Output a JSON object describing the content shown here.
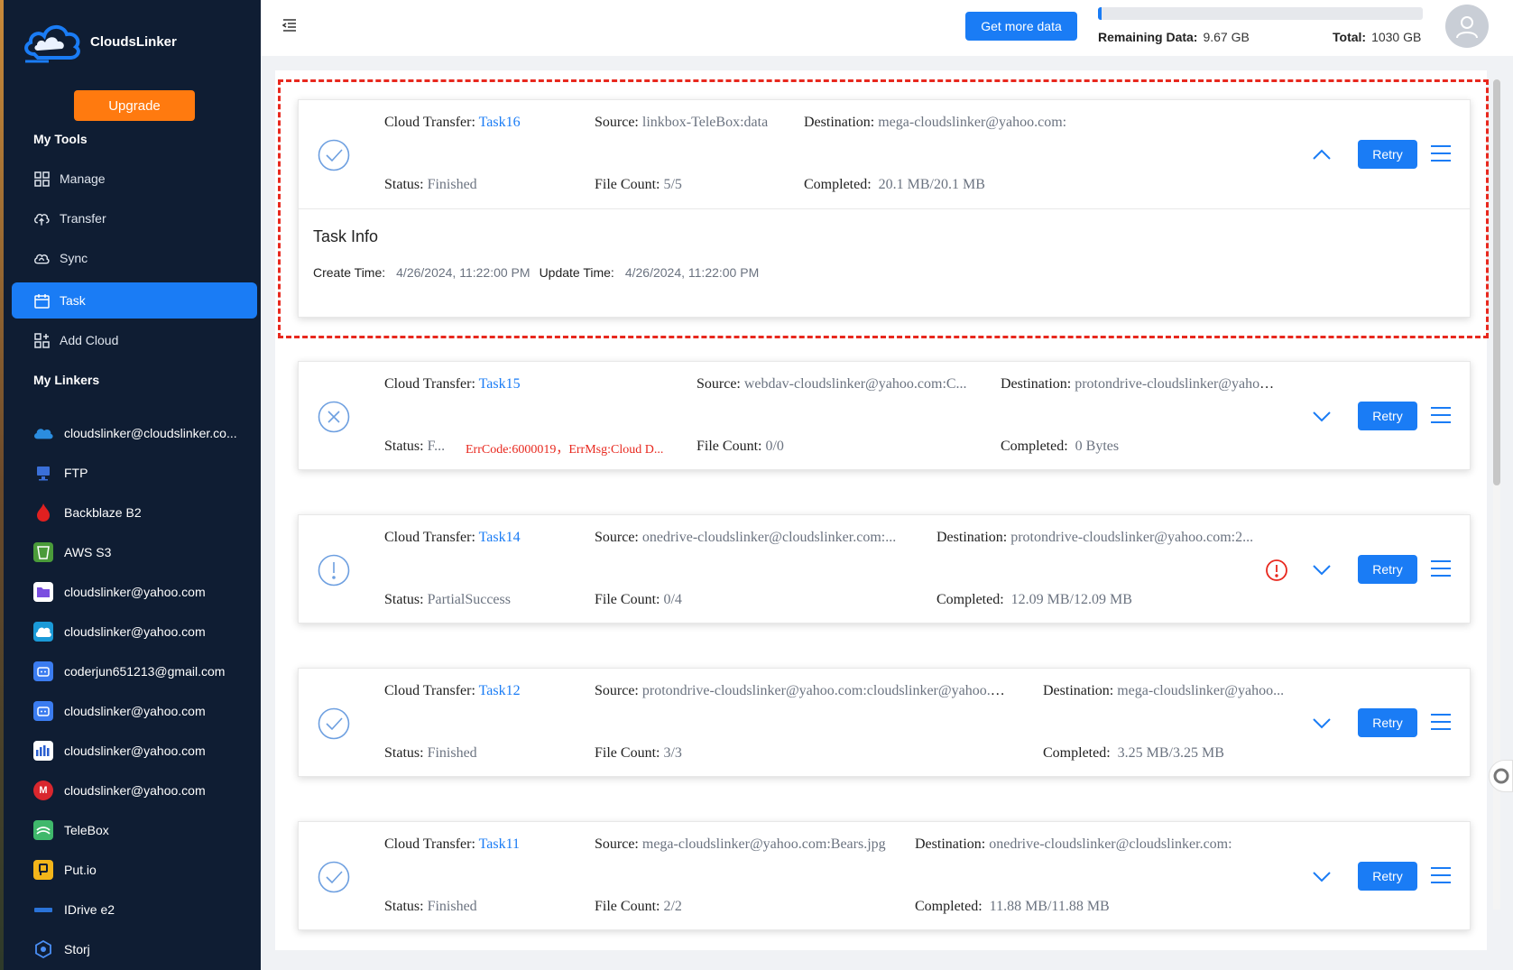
{
  "app": {
    "name": "CloudsLinker"
  },
  "sidebar": {
    "upgrade_label": "Upgrade",
    "my_tools_title": "My Tools",
    "tools": [
      {
        "label": "Manage",
        "icon": "grid-icon"
      },
      {
        "label": "Transfer",
        "icon": "cloud-upload-icon"
      },
      {
        "label": "Sync",
        "icon": "cloud-sync-icon"
      },
      {
        "label": "Task",
        "icon": "calendar-icon",
        "active": true
      },
      {
        "label": "Add Cloud",
        "icon": "add-grid-icon"
      }
    ],
    "my_linkers_title": "My Linkers",
    "linkers": [
      {
        "label": "cloudslinker@cloudslinker.co...",
        "icon": "onedrive-icon",
        "color": "#2b8de0"
      },
      {
        "label": "FTP",
        "icon": "ftp-icon",
        "color": "#3a6fd8"
      },
      {
        "label": "Backblaze B2",
        "icon": "backblaze-icon",
        "color": "#e02020"
      },
      {
        "label": "AWS S3",
        "icon": "aws-s3-icon",
        "color": "#4a9b3a"
      },
      {
        "label": "cloudslinker@yahoo.com",
        "icon": "protondrive-icon",
        "color": "#7a4ee0"
      },
      {
        "label": "cloudslinker@yahoo.com",
        "icon": "pcloud-icon",
        "color": "#1a9ad8"
      },
      {
        "label": "coderjun651213@gmail.com",
        "icon": "box-bot-icon",
        "color": "#3b7cf0"
      },
      {
        "label": "cloudslinker@yahoo.com",
        "icon": "box-bot-icon",
        "color": "#3b7cf0"
      },
      {
        "label": "cloudslinker@yahoo.com",
        "icon": "bars-icon",
        "color": "#2a5fd0"
      },
      {
        "label": "cloudslinker@yahoo.com",
        "icon": "mega-icon",
        "color": "#d9272e"
      },
      {
        "label": "TeleBox",
        "icon": "telebox-icon",
        "color": "#3fb86b"
      },
      {
        "label": "Put.io",
        "icon": "putio-icon",
        "color": "#f3b51a"
      },
      {
        "label": "IDrive e2",
        "icon": "idrive-icon",
        "color": "#2a73d8"
      },
      {
        "label": "Storj",
        "icon": "storj-icon",
        "color": "#2a5fd0"
      }
    ]
  },
  "header": {
    "get_more_label": "Get more data",
    "remaining_label": "Remaining Data:",
    "remaining_value": "9.67 GB",
    "total_label": "Total:",
    "total_value": "1030 GB",
    "used_fraction": 0.01
  },
  "labels": {
    "cloud_transfer": "Cloud Transfer:",
    "source": "Source:",
    "destination": "Destination:",
    "status": "Status:",
    "file_count": "File Count:",
    "completed": "Completed:",
    "retry": "Retry",
    "task_info": "Task Info",
    "create_time": "Create Time:",
    "update_time": "Update Time:"
  },
  "tasks": [
    {
      "name": "Task16",
      "source": "linkbox-TeleBox:data",
      "destination": "mega-cloudslinker@yahoo.com:",
      "status": "Finished",
      "file_count": "5/5",
      "completed": "20.1 MB/20.1 MB",
      "expanded": true,
      "create_time": "4/26/2024, 11:22:00 PM",
      "update_time": "4/26/2024, 11:22:00 PM"
    },
    {
      "name": "Task15",
      "source": "webdav-cloudslinker@yahoo.com:C...",
      "destination": "protondrive-cloudslinker@yahoo....",
      "status": "F...",
      "error": "ErrCode:6000019，ErrMsg:Cloud D...",
      "file_count": "0/0",
      "completed": "0 Bytes"
    },
    {
      "name": "Task14",
      "source": "onedrive-cloudslinker@cloudslinker.com:...",
      "destination": "protondrive-cloudslinker@yahoo.com:2...",
      "status": "PartialSuccess",
      "file_count": "0/4",
      "completed": "12.09 MB/12.09 MB"
    },
    {
      "name": "Task12",
      "source": "protondrive-cloudslinker@yahoo.com:cloudslinker@yahoo.c...",
      "destination": "mega-cloudslinker@yahoo...",
      "status": "Finished",
      "file_count": "3/3",
      "completed": "3.25 MB/3.25 MB"
    },
    {
      "name": "Task11",
      "source": "mega-cloudslinker@yahoo.com:Bears.jpg",
      "destination": "onedrive-cloudslinker@cloudslinker.com:",
      "status": "Finished",
      "file_count": "2/2",
      "completed": "11.88 MB/11.88 MB"
    }
  ]
}
